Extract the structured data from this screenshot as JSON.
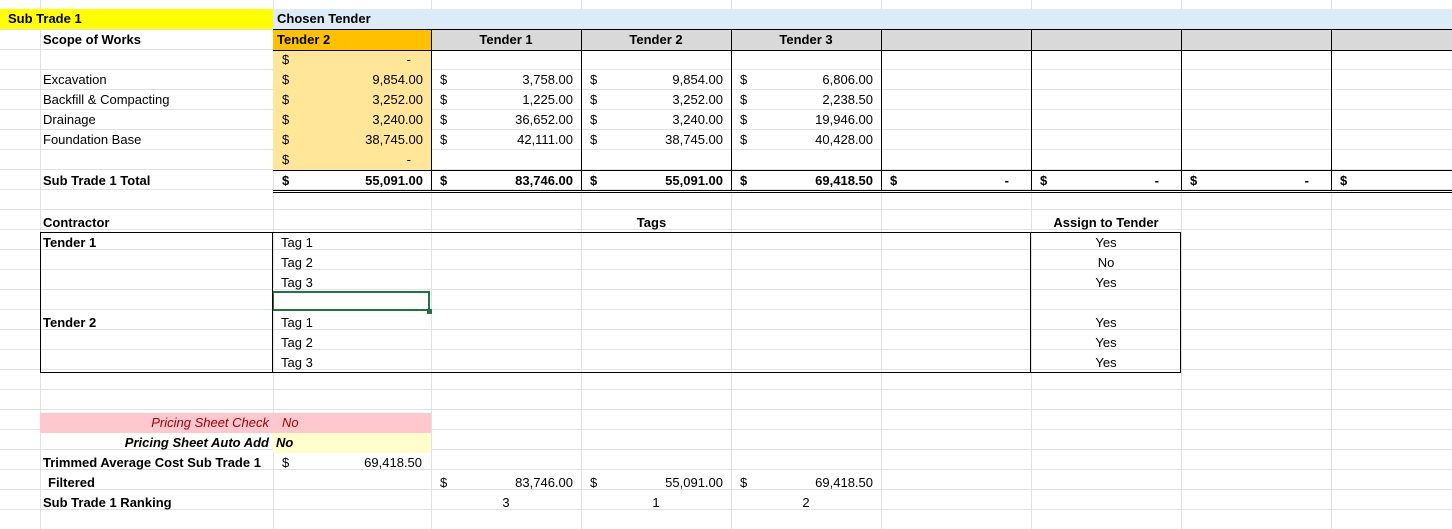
{
  "header": {
    "sub_trade": "Sub Trade 1",
    "chosen_tender_label": "Chosen Tender",
    "scope_label": "Scope of Works",
    "chosen_tender_value": "Tender 2",
    "tender_headers": [
      "Tender 1",
      "Tender 2",
      "Tender 3"
    ]
  },
  "scope_rows": [
    {
      "name": "",
      "chosen": "-",
      "t1": "",
      "t2": "",
      "t3": ""
    },
    {
      "name": "Excavation",
      "chosen": "9,854.00",
      "t1": "3,758.00",
      "t2": "9,854.00",
      "t3": "6,806.00"
    },
    {
      "name": "Backfill & Compacting",
      "chosen": "3,252.00",
      "t1": "1,225.00",
      "t2": "3,252.00",
      "t3": "2,238.50"
    },
    {
      "name": "Drainage",
      "chosen": "3,240.00",
      "t1": "36,652.00",
      "t2": "3,240.00",
      "t3": "19,946.00"
    },
    {
      "name": "Foundation Base",
      "chosen": "38,745.00",
      "t1": "42,111.00",
      "t2": "38,745.00",
      "t3": "40,428.00"
    },
    {
      "name": "",
      "chosen": "-",
      "t1": "",
      "t2": "",
      "t3": ""
    }
  ],
  "currency": "$",
  "total": {
    "label": "Sub Trade 1 Total",
    "chosen": "55,091.00",
    "t1": "83,746.00",
    "t2": "55,091.00",
    "t3": "69,418.50",
    "extra": [
      "-",
      "-",
      "-"
    ]
  },
  "contractors": {
    "contractor_label": "Contractor",
    "tags_label": "Tags",
    "assign_label": "Assign to Tender",
    "groups": [
      {
        "name": "Tender 1",
        "tags": [
          "Tag 1",
          "Tag 2",
          "Tag 3"
        ],
        "assign": [
          "Yes",
          "No",
          "Yes"
        ]
      },
      {
        "name": "Tender 2",
        "tags": [
          "Tag 1",
          "Tag 2",
          "Tag 3"
        ],
        "assign": [
          "Yes",
          "Yes",
          "Yes"
        ]
      }
    ]
  },
  "summary": {
    "pricing_check_label": "Pricing Sheet Check",
    "pricing_check_value": "No",
    "auto_add_label": "Pricing Sheet Auto Add",
    "auto_add_value": "No",
    "trimmed_label": "Trimmed Average Cost Sub Trade 1",
    "trimmed_value": "69,418.50",
    "filtered_label": "Filtered",
    "filtered": [
      "83,746.00",
      "55,091.00",
      "69,418.50"
    ],
    "ranking_label": "Sub Trade 1 Ranking",
    "ranking": [
      "3",
      "1",
      "2"
    ]
  },
  "colors": {
    "sub_trade_yellow": "#FFFF00",
    "chosen_header_blue": "#DDEBF7",
    "chosen_orange": "#FFC000",
    "chosen_light": "#FFE699",
    "tender_header_gray": "#D9D9D9",
    "check_pink": "#FFC7CE",
    "check_red_text": "#9C0006",
    "auto_add_yellow": "#FFFFCC",
    "selected_green": "#217346"
  }
}
